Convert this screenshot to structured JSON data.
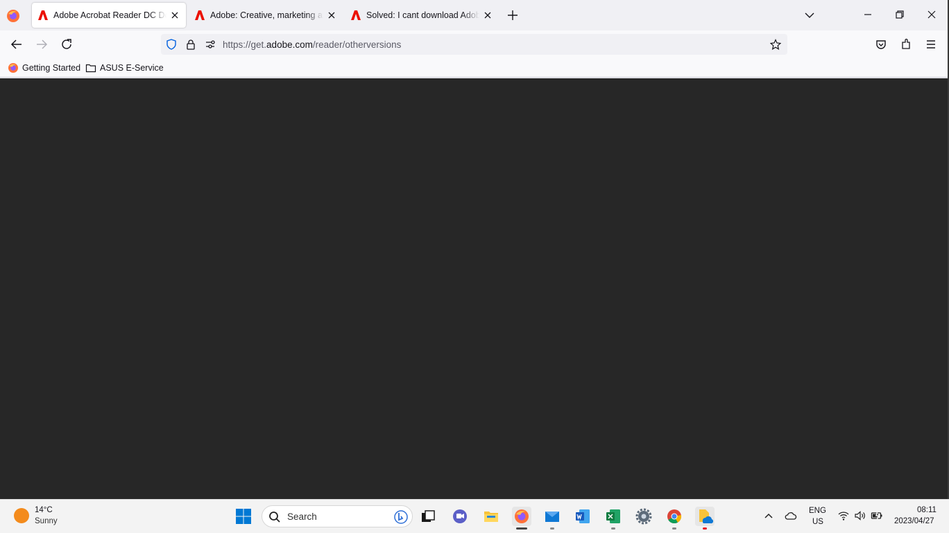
{
  "browser": {
    "tabs": [
      {
        "title": "Adobe Acrobat Reader DC Download",
        "active": true
      },
      {
        "title": "Adobe: Creative, marketing and document management",
        "active": false
      },
      {
        "title": "Solved: I cant download Adobe Reader",
        "active": false
      }
    ],
    "url_prefix": "https://get.",
    "url_domain": "adobe.com",
    "url_path": "/reader/otherversions",
    "bookmarks": [
      {
        "label": "Getting Started",
        "icon": "firefox-icon"
      },
      {
        "label": "ASUS E-Service",
        "icon": "folder-icon"
      }
    ]
  },
  "taskbar": {
    "weather": {
      "temp": "14°C",
      "desc": "Sunny"
    },
    "search_placeholder": "Search",
    "lang_top": "ENG",
    "lang_bottom": "US",
    "time": "08:11",
    "date": "2023/04/27"
  },
  "colors": {
    "content_bg": "#272727",
    "adobe_red": "#eb1000",
    "accent": "#0060df"
  }
}
